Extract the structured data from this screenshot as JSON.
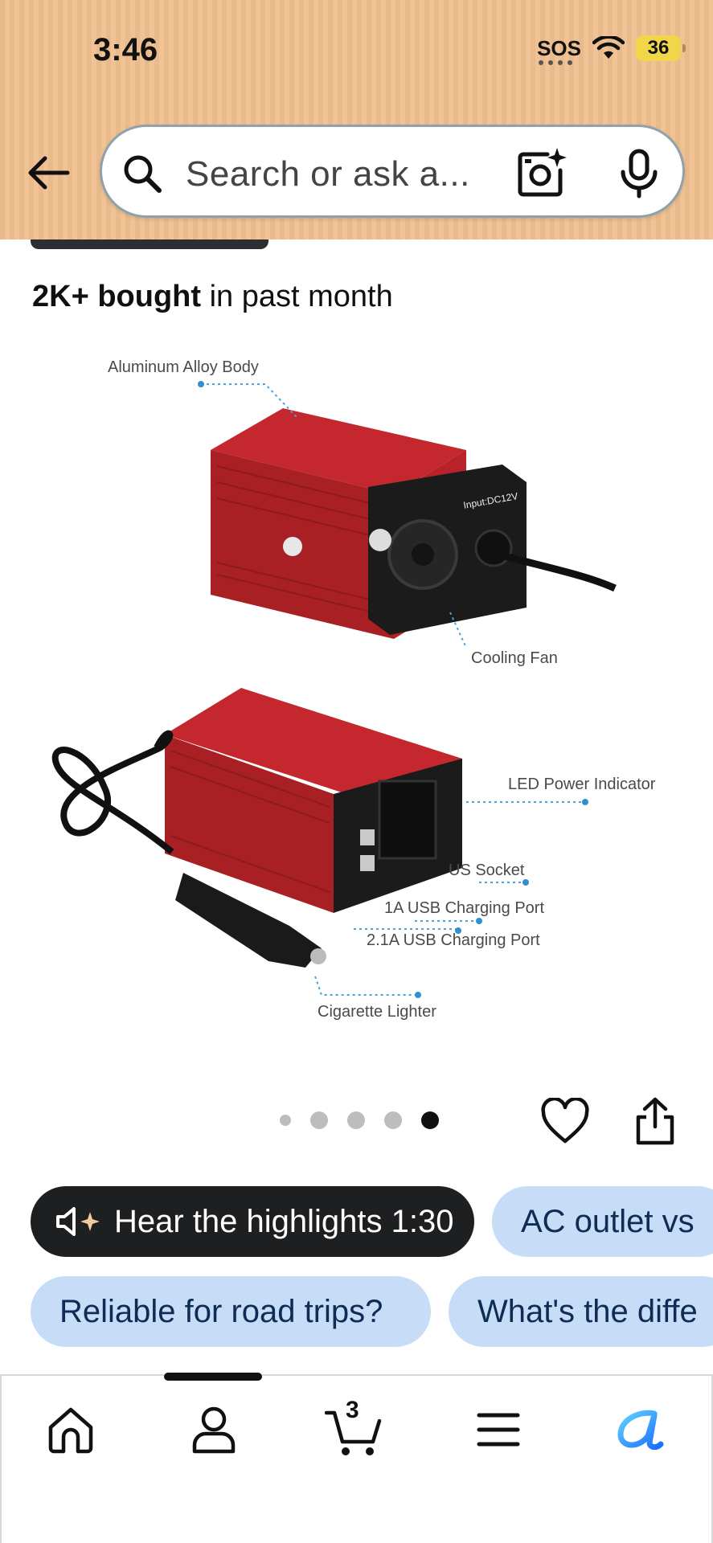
{
  "status_bar": {
    "time": "3:46",
    "carrier": "SOS",
    "battery": "36",
    "icons": [
      "wifi-icon",
      "battery-icon"
    ]
  },
  "search": {
    "placeholder": "Search or ask a...",
    "icons": [
      "back-arrow-icon",
      "search-icon",
      "camera-lens-icon",
      "microphone-icon"
    ]
  },
  "product": {
    "bought_count": "2K+ bought",
    "bought_suffix": " in past month",
    "image_callouts": {
      "body": "Aluminum Alloy Body",
      "input": "Input:DC12V",
      "fan": "Cooling Fan",
      "led": "LED Power Indicator",
      "socket": "US Socket",
      "usb1": "1A USB Charging Port",
      "usb2": "2.1A USB Charging Port",
      "lighter": "Cigarette Lighter"
    }
  },
  "carousel": {
    "total_images": 5,
    "active_index": 4
  },
  "chips": {
    "highlights": "Hear the highlights 1:30",
    "q1": "AC outlet vs",
    "q2": "Reliable for road trips?",
    "q3": "What's the diffe"
  },
  "nav": {
    "items": [
      "home-icon",
      "account-icon",
      "cart-icon",
      "menu-icon",
      "rufus-icon"
    ],
    "cart_count": "3"
  },
  "colors": {
    "header_bg": "#f0c090",
    "chip_blue": "#c6dcf7",
    "chip_dark": "#1e1f21",
    "product_red": "#c0272d",
    "accent_blue": "#1a8cff"
  }
}
